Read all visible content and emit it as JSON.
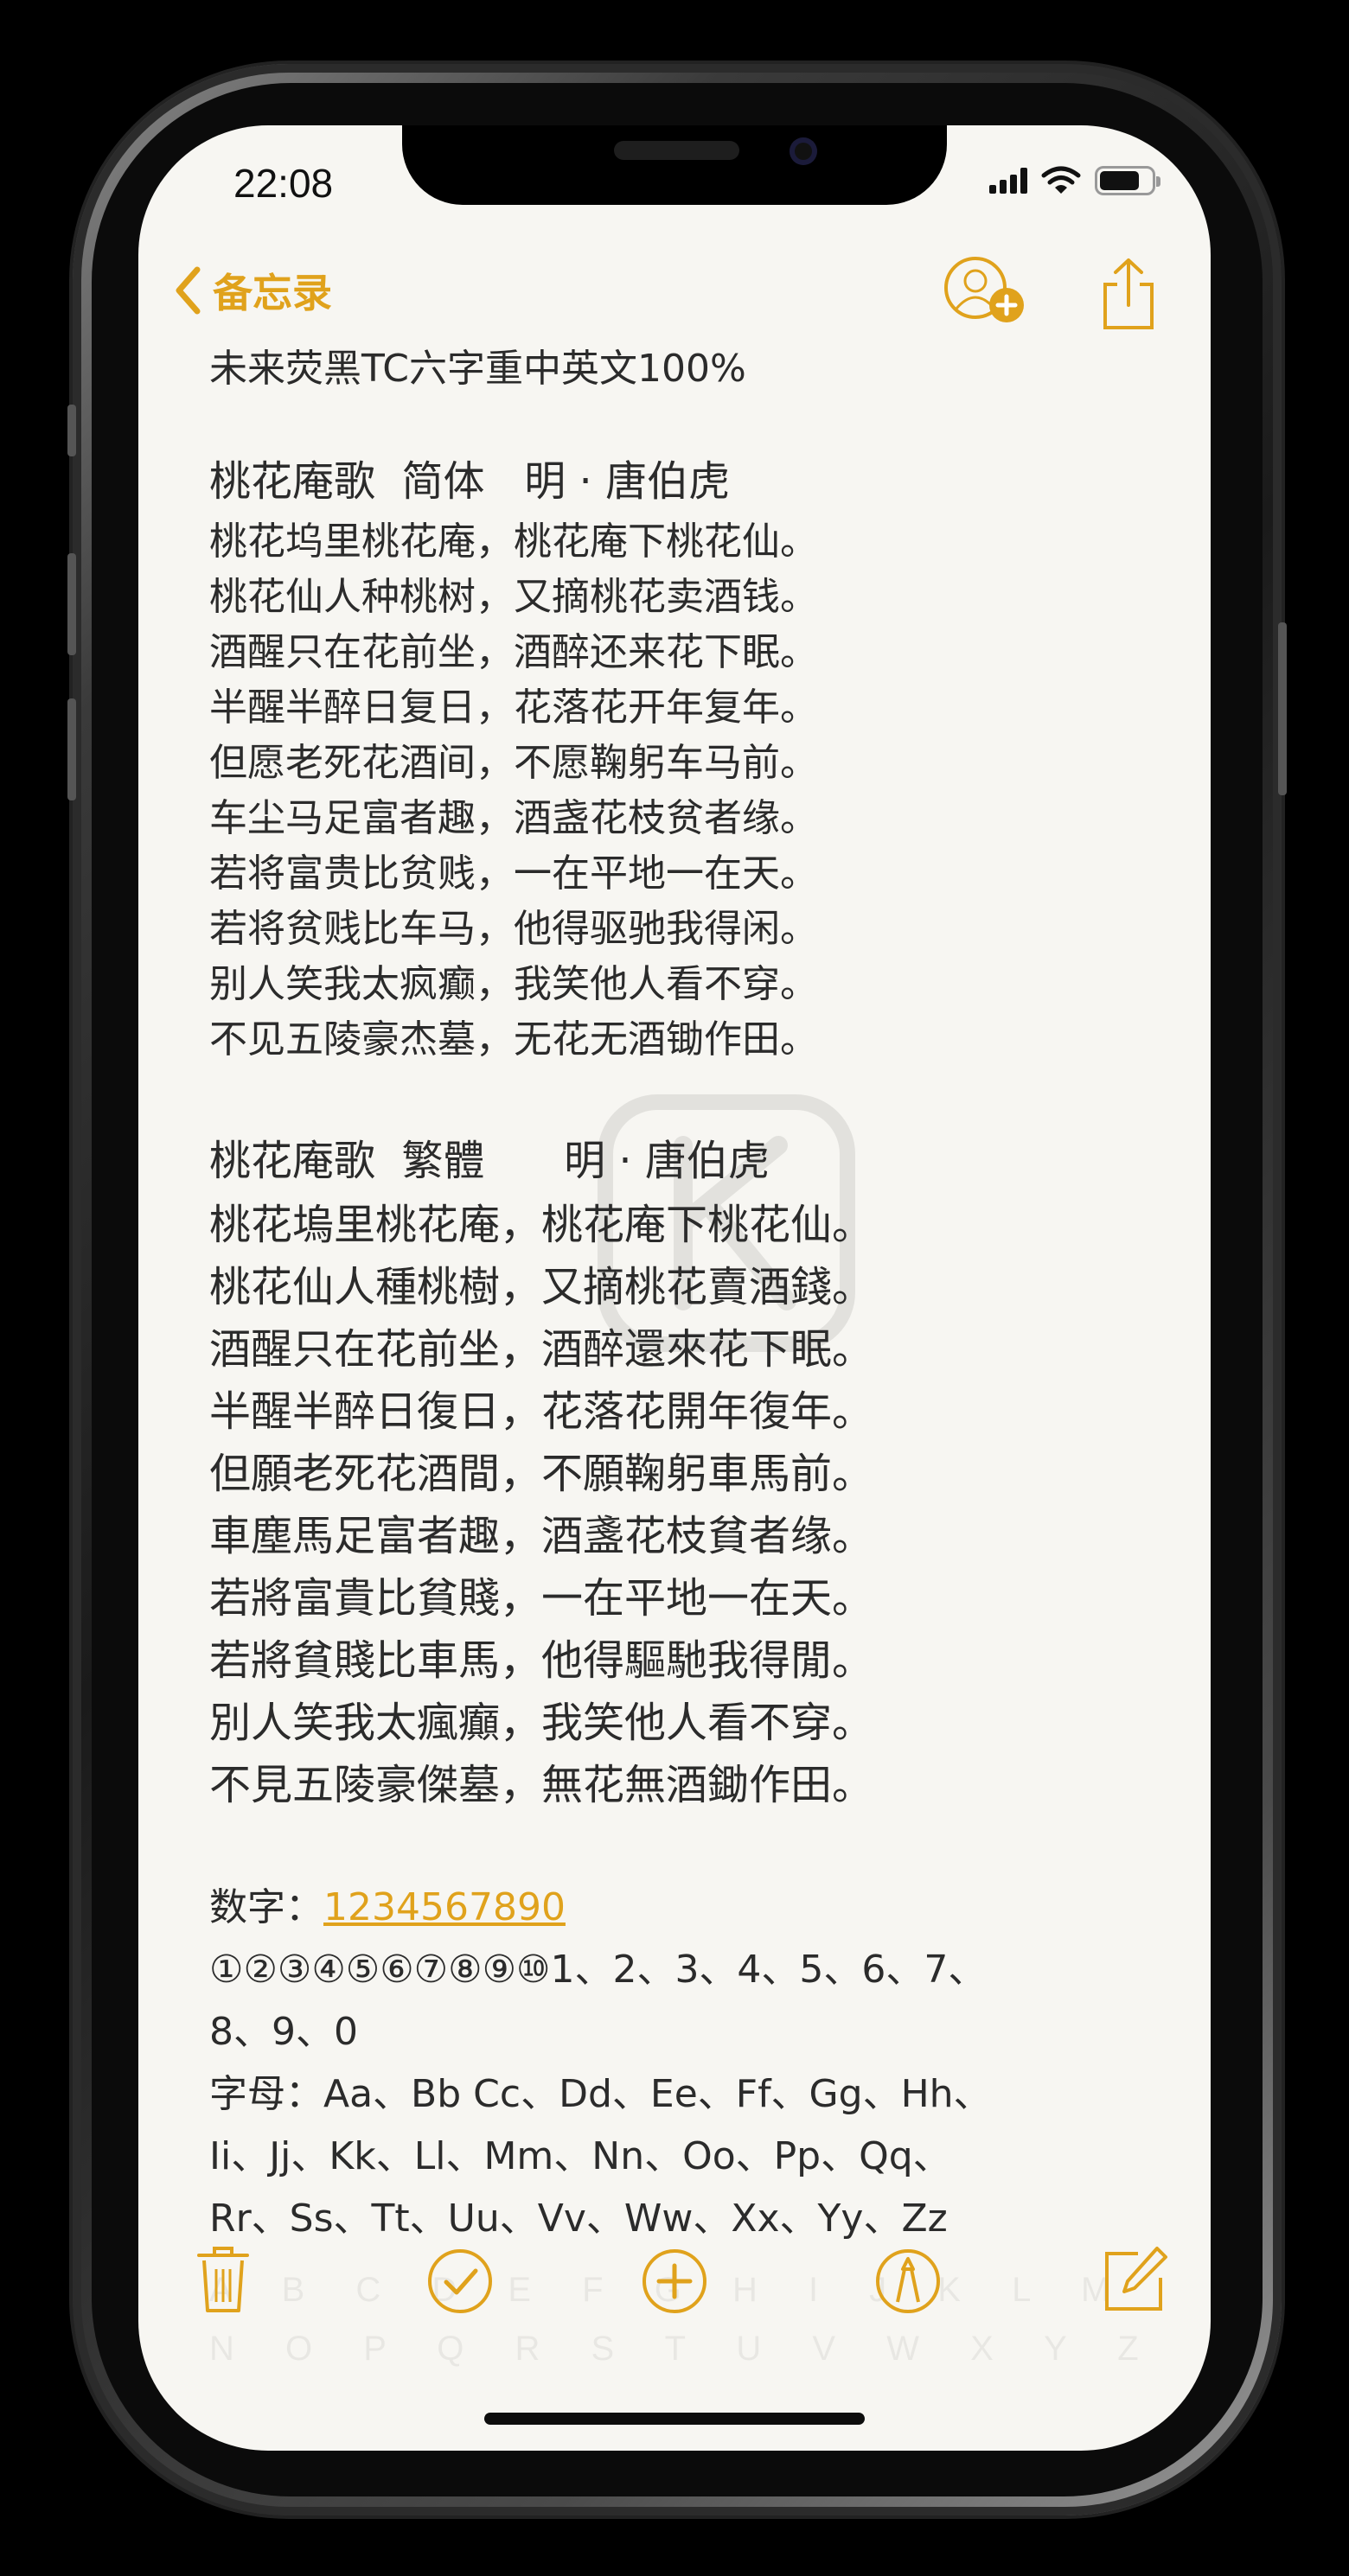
{
  "status_bar": {
    "time": "22:08"
  },
  "nav": {
    "back_label": "备忘录"
  },
  "note": {
    "header": "未来荧黑TC六字重中英文100%",
    "simplified": {
      "title": "桃花庵歌  简体   明 · 唐伯虎",
      "lines": [
        "桃花坞里桃花庵，桃花庵下桃花仙。",
        "桃花仙人种桃树，又摘桃花卖酒钱。",
        "酒醒只在花前坐，酒醉还来花下眠。",
        "半醒半醉日复日，花落花开年复年。",
        "但愿老死花酒间，不愿鞠躬车马前。",
        "车尘马足富者趣，酒盏花枝贫者缘。",
        "若将富贵比贫贱，一在平地一在天。",
        "若将贫贱比车马，他得驱驰我得闲。",
        "别人笑我太疯癫，我笑他人看不穿。",
        "不见五陵豪杰墓，无花无酒锄作田。"
      ]
    },
    "traditional": {
      "title": "桃花庵歌  繁體      明 · 唐伯虎",
      "lines": [
        "桃花塢里桃花庵，桃花庵下桃花仙。",
        "桃花仙人種桃樹，又摘桃花賣酒錢。",
        "酒醒只在花前坐，酒醉還來花下眠。",
        "半醒半醉日復日，花落花開年復年。",
        "但願老死花酒間，不願鞠躬車馬前。",
        "車塵馬足富者趣，酒盞花枝貧者缘。",
        "若將富貴比貧賤，一在平地一在天。",
        "若將貧賤比車馬，他得驅馳我得閒。",
        "別人笑我太瘋癲，我笑他人看不穿。",
        "不見五陵豪傑墓，無花無酒鋤作田。"
      ]
    },
    "numbers": {
      "label": "数字：",
      "link": "1234567890",
      "line2": "①②③④⑤⑥⑦⑧⑨⑩1、2、3、4、5、6、7、",
      "line3": "8、9、0"
    },
    "letters": {
      "line1": "字母：Aa、Bb Cc、Dd、Ee、Ff、Gg、Hh、",
      "line2": "Ii、Jj、Kk、Ll、Mm、Nn、Oo、Pp、Qq、",
      "line3": "Rr、Ss、Tt、Uu、Vv、Ww、Xx、Yy、Zz"
    },
    "ghost_lines": [
      "A B C D E F G H I J K L M",
      "N O P Q R S T U V W X Y Z"
    ]
  },
  "colors": {
    "accent": "#e0a21c",
    "paper": "#f7f6f2",
    "text": "#2b2b2b"
  },
  "icons": {
    "back": "chevron-left-icon",
    "add_person": "add-person-icon",
    "share": "share-icon",
    "trash": "trash-icon",
    "checklist": "checklist-icon",
    "add": "add-icon",
    "markup": "markup-pen-icon",
    "compose": "compose-icon"
  }
}
